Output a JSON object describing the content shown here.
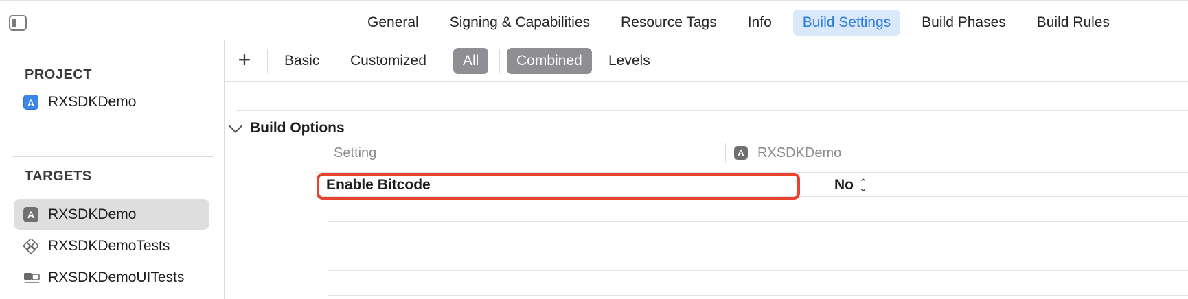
{
  "tabs": [
    {
      "label": "General"
    },
    {
      "label": "Signing & Capabilities"
    },
    {
      "label": "Resource Tags"
    },
    {
      "label": "Info"
    },
    {
      "label": "Build Settings"
    },
    {
      "label": "Build Phases"
    },
    {
      "label": "Build Rules"
    }
  ],
  "active_tab": "Build Settings",
  "sidebar": {
    "project_title": "PROJECT",
    "project_item": {
      "label": "RXSDKDemo",
      "icon": "app-project-icon"
    },
    "targets_title": "TARGETS",
    "targets": [
      {
        "label": "RXSDKDemo",
        "icon": "app-target-icon",
        "selected": true
      },
      {
        "label": "RXSDKDemoTests",
        "icon": "unit-test-icon",
        "selected": false
      },
      {
        "label": "RXSDKDemoUITests",
        "icon": "ui-test-icon",
        "selected": false
      }
    ]
  },
  "filterbar": {
    "add_label": "+",
    "filters": [
      {
        "label": "Basic",
        "on": false
      },
      {
        "label": "Customized",
        "on": false
      },
      {
        "label": "All",
        "on": true
      },
      {
        "label": "Combined",
        "on": true
      },
      {
        "label": "Levels",
        "on": false
      }
    ]
  },
  "group": {
    "title": "Build Options",
    "column_setting": "Setting",
    "column_target": "RXSDKDemo",
    "rows": [
      {
        "name": "Enable Bitcode",
        "value": "No"
      }
    ]
  },
  "colors": {
    "accent_tab_bg": "#d9e8fb",
    "accent_tab_text": "#2f7ce0",
    "filter_on_bg": "#8e8e93",
    "highlight": "#e8432e",
    "selected_row": "#dedede"
  }
}
